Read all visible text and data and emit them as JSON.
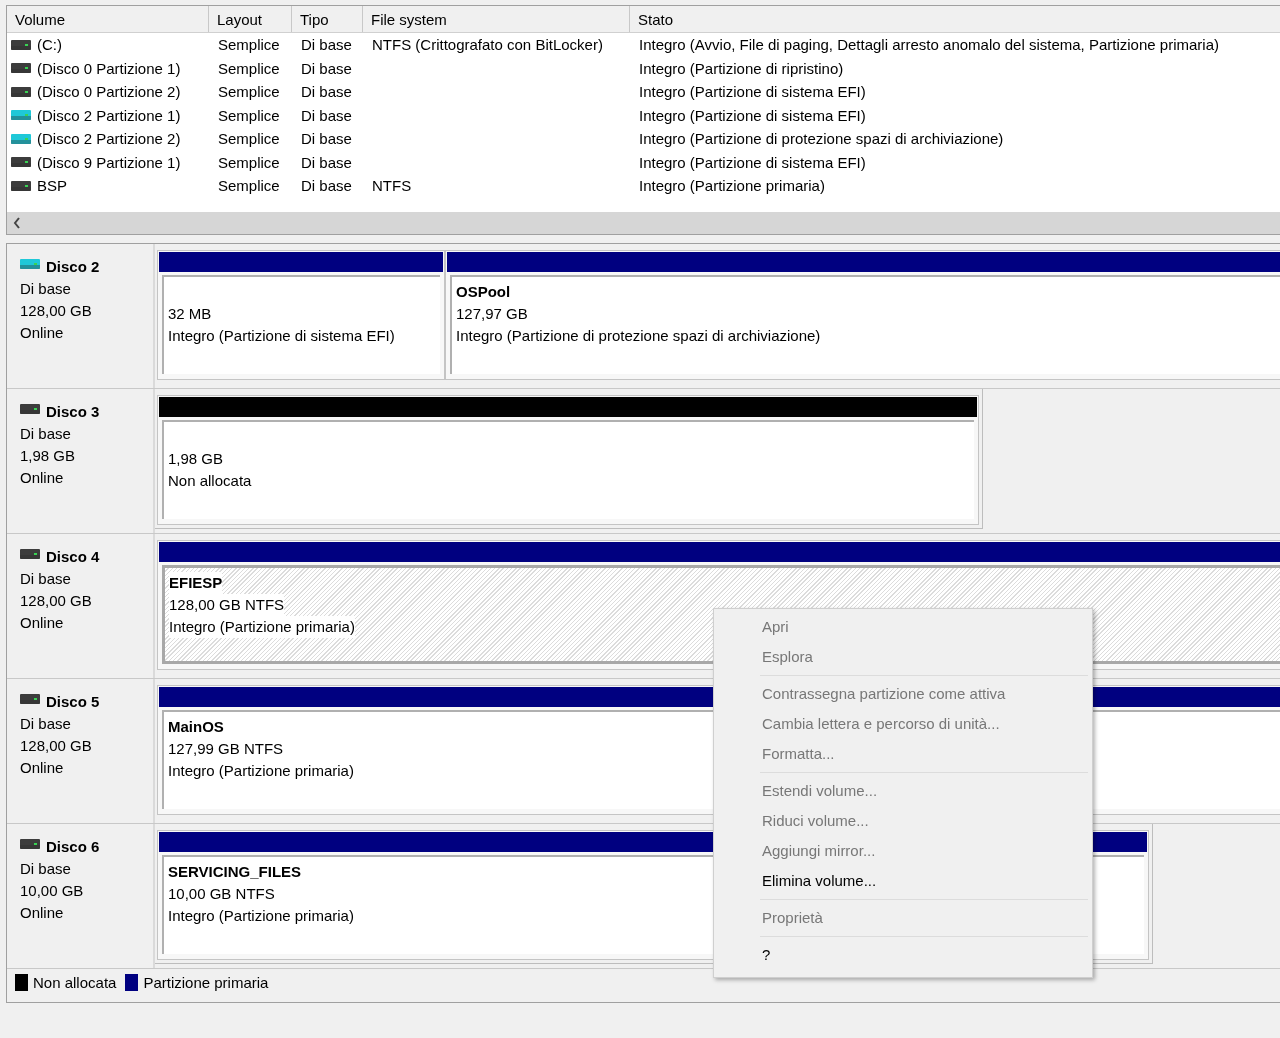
{
  "volume_list": {
    "columns": [
      "Volume",
      "Layout",
      "Tipo",
      "File system",
      "Stato"
    ],
    "rows": [
      {
        "volume": "(C:)",
        "layout": "Semplice",
        "type": "Di base",
        "file_system": "NTFS (Crittografato con BitLocker)",
        "status": "Integro (Avvio, File di paging, Dettagli arresto anomalo del sistema, Partizione primaria)",
        "color": "#3c3c3c"
      },
      {
        "volume": "(Disco 0 Partizione 1)",
        "layout": "Semplice",
        "type": "Di base",
        "status": "Integro (Partizione di ripristino)",
        "color": "#3c3c3c"
      },
      {
        "volume": "(Disco 0 Partizione 2)",
        "layout": "Semplice",
        "type": "Di base",
        "status": "Integro (Partizione di sistema EFI)",
        "color": "#3c3c3c"
      },
      {
        "volume": "(Disco 2 Partizione 1)",
        "layout": "Semplice",
        "type": "Di base",
        "status": "Integro (Partizione di sistema EFI)",
        "color": "#1fc8d8"
      },
      {
        "volume": "(Disco 2 Partizione 2)",
        "layout": "Semplice",
        "type": "Di base",
        "status": "Integro (Partizione di protezione spazi di archiviazione)",
        "color": "#1fc8d8"
      },
      {
        "volume": "(Disco 9 Partizione 1)",
        "layout": "Semplice",
        "type": "Di base",
        "status": "Integro (Partizione di sistema EFI)",
        "color": "#3c3c3c"
      },
      {
        "volume": "BSP",
        "layout": "Semplice",
        "type": "Di base",
        "file_system": "NTFS",
        "status": "Integro (Partizione primaria)",
        "color": "#3c3c3c"
      }
    ]
  },
  "disks": [
    {
      "name": "Disco 2",
      "type": "Di base",
      "size": "128,00 GB",
      "state": "Online",
      "color": "#1fc8d8",
      "partitions": [
        {
          "kind": "primary",
          "size": "32 MB",
          "status": "Integro (Partizione di sistema EFI)",
          "selected": false
        },
        {
          "kind": "primary",
          "name": "OSPool",
          "size": "127,97 GB",
          "status": "Integro (Partizione di protezione spazi di archiviazione)",
          "selected": false
        }
      ]
    },
    {
      "name": "Disco 3",
      "type": "Di base",
      "size": "1,98 GB",
      "state": "Online",
      "color": "#3c3c3c",
      "partitions": [
        {
          "kind": "unallocated",
          "size": "1,98 GB",
          "status": "Non allocata",
          "selected": false
        }
      ]
    },
    {
      "name": "Disco 4",
      "type": "Di base",
      "size": "128,00 GB",
      "state": "Online",
      "color": "#3c3c3c",
      "partitions": [
        {
          "kind": "primary",
          "name": "EFIESP",
          "size": "128,00 GB NTFS",
          "status": "Integro (Partizione primaria)",
          "selected": true
        }
      ]
    },
    {
      "name": "Disco 5",
      "type": "Di base",
      "size": "128,00 GB",
      "state": "Online",
      "color": "#3c3c3c",
      "partitions": [
        {
          "kind": "primary",
          "name": "MainOS",
          "size": "127,99 GB NTFS",
          "status": "Integro (Partizione primaria)",
          "selected": false
        }
      ]
    },
    {
      "name": "Disco 6",
      "type": "Di base",
      "size": "10,00 GB",
      "state": "Online",
      "color": "#3c3c3c",
      "partitions": [
        {
          "kind": "primary",
          "name": "SERVICING_FILES",
          "size": "10,00 GB NTFS",
          "status": "Integro (Partizione primaria)",
          "selected": false
        }
      ]
    }
  ],
  "legend": [
    {
      "label": "Non allocata",
      "color": "#000000"
    },
    {
      "label": "Partizione primaria",
      "color": "#000080"
    }
  ],
  "context_menu": {
    "groups": [
      [
        {
          "label": "Apri",
          "disabled": true
        },
        {
          "label": "Esplora",
          "disabled": true
        }
      ],
      [
        {
          "label": "Contrassegna partizione come attiva",
          "disabled": true
        },
        {
          "label": "Cambia lettera e percorso di unità...",
          "disabled": true
        },
        {
          "label": "Formatta...",
          "disabled": true
        }
      ],
      [
        {
          "label": "Estendi volume...",
          "disabled": true
        },
        {
          "label": "Riduci volume...",
          "disabled": true
        },
        {
          "label": "Aggiungi mirror...",
          "disabled": true
        },
        {
          "label": "Elimina volume...",
          "disabled": false
        }
      ],
      [
        {
          "label": "Proprietà",
          "disabled": true
        }
      ],
      [
        {
          "label": "?",
          "disabled": false
        }
      ]
    ]
  }
}
